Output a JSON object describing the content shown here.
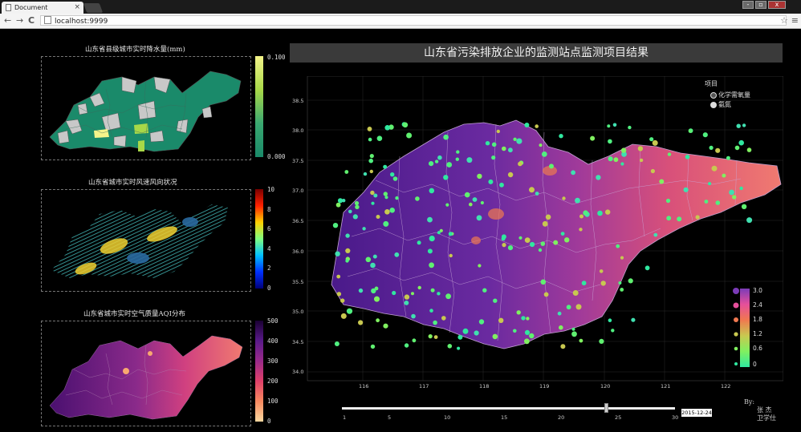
{
  "browser": {
    "tab_title": "Document",
    "tab_close": "×",
    "back": "←",
    "forward": "→",
    "reload": "C",
    "url": "localhost:9999",
    "bookmark": "☆",
    "menu": "≡"
  },
  "panels": {
    "rainfall": {
      "title": "山东省县级城市实时降水量(mm)",
      "cbar_max": "0.100",
      "cbar_min": "0.000",
      "colors": {
        "low": "#1a8a6a",
        "high": "#f4f48a",
        "missing": "#c8c8c8"
      }
    },
    "wind": {
      "title": "山东省城市实时风速风向状况",
      "cbar_labels": [
        "10",
        "8",
        "6",
        "4",
        "2",
        "0"
      ],
      "colormap": [
        "#7a0000",
        "#ff2000",
        "#ffd000",
        "#80ff80",
        "#00c0ff",
        "#0030ff",
        "#00007a"
      ]
    },
    "aqi": {
      "title": "山东省城市实时空气质量AQI分布",
      "cbar_labels": [
        "500",
        "400",
        "300",
        "200",
        "100",
        "0"
      ],
      "colormap": [
        "#1a0033",
        "#5a1a8a",
        "#9a2a8a",
        "#e0406a",
        "#f88a60",
        "#f8d8a0"
      ]
    }
  },
  "main": {
    "title": "山东省污染排放企业的监测站点监测项目结果",
    "legend_title": "项目",
    "legend_items": [
      "化学需氧量",
      "氨氮"
    ],
    "y_ticks": [
      "38.5",
      "38.0",
      "37.5",
      "37.0",
      "36.5",
      "36.0",
      "35.5",
      "35.0",
      "34.5",
      "34.0"
    ],
    "x_ticks": [
      "116",
      "117",
      "118",
      "119",
      "120",
      "121",
      "122"
    ],
    "size_legend": [
      "3.0",
      "2.4",
      "1.8",
      "1.2",
      "0.6",
      "0"
    ],
    "size_legend_colors": [
      "#7b3bb8",
      "#e54f9b",
      "#f07850",
      "#c8c850",
      "#80f060",
      "#30e8a0"
    ]
  },
  "slider": {
    "ticks": [
      "1",
      "5",
      "10",
      "15",
      "20",
      "25",
      "30"
    ],
    "min": 1,
    "max": 30,
    "value": 24,
    "date": "2015-12-24"
  },
  "byline": {
    "label": "By:",
    "names": [
      "张  杰",
      "卫学仕"
    ]
  }
}
